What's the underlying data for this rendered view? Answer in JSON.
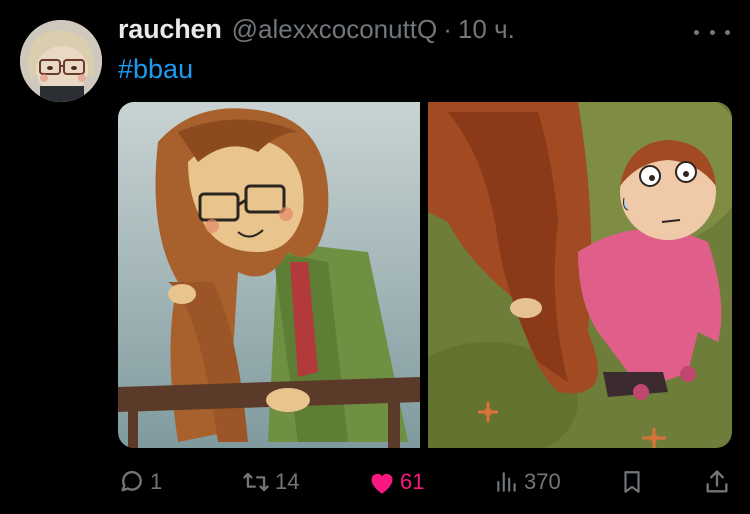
{
  "tweet": {
    "author": {
      "name": "rauchen",
      "handle": "@alexxcoconuttQ",
      "separator": "·",
      "time": "10 ч."
    },
    "text": "#bbau",
    "actions": {
      "replies": "1",
      "reposts": "14",
      "likes": "61",
      "views": "370"
    },
    "liked": true
  },
  "colors": {
    "background": "#000000",
    "primary_text": "#e7e9ea",
    "secondary_text": "#71767b",
    "link": "#1d9bf0",
    "like": "#f91880"
  },
  "icons": [
    "more-icon",
    "reply-icon",
    "repost-icon",
    "like-icon",
    "views-icon",
    "bookmark-icon",
    "share-icon"
  ]
}
